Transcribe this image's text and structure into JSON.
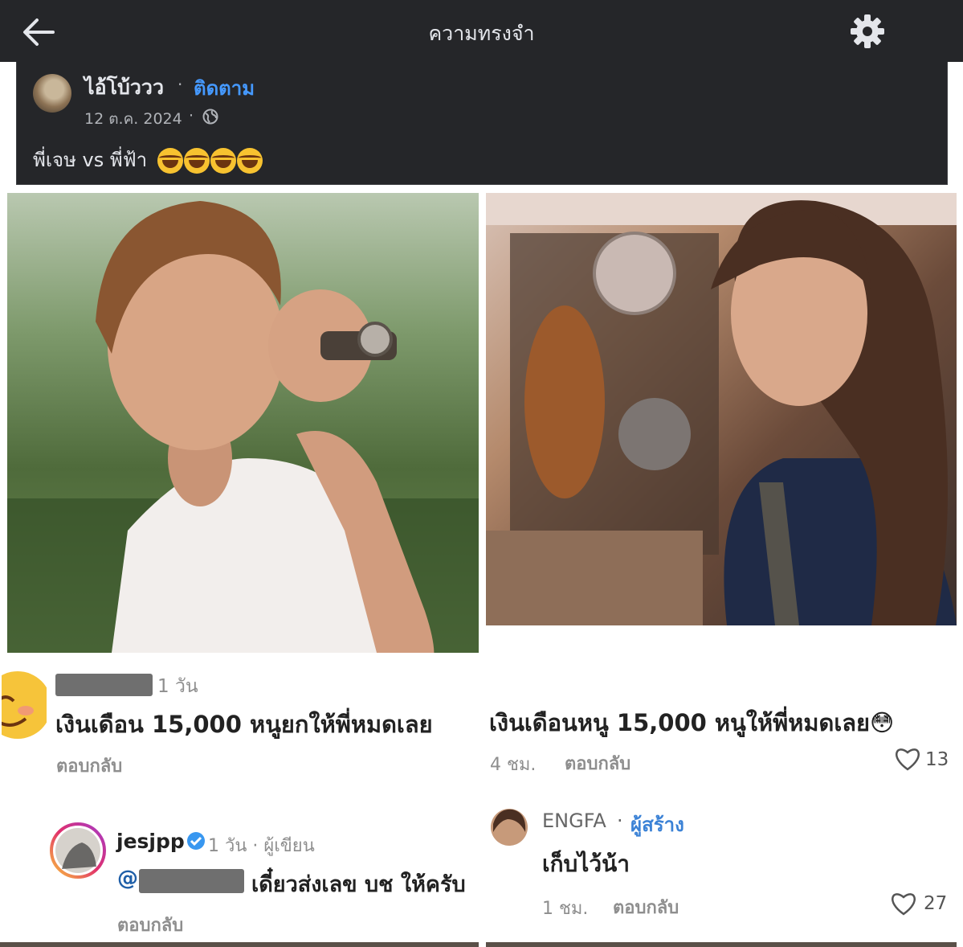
{
  "header": {
    "title": "ความทรงจำ"
  },
  "post": {
    "author": "ไอ้โบ้ววว",
    "separator": "·",
    "follow": "ติดตาม",
    "date": "12 ต.ค. 2024",
    "date_sep": "·",
    "message": "พี่เจษ vs พี่ฟ้า"
  },
  "left_card": {
    "comment_time": "1 วัน",
    "comment_text": "เงินเดือน 15,000 หนูยกให้พี่หมดเลย",
    "reply_label": "ตอบกลับ",
    "reply": {
      "username": "jesjpp",
      "meta": "1 วัน · ผู้เขียน",
      "mention_at": "@",
      "text": "เดี๋ยวส่งเลข บช ให้ครับ",
      "reply_label": "ตอบกลับ"
    }
  },
  "right_card": {
    "comment_text": "เงินเดือนหนู 15,000 หนูให้พี่หมดเลย😳",
    "comment_time": "4 ชม.",
    "reply_label": "ตอบกลับ",
    "likes": "13",
    "reply": {
      "username": "ENGFA",
      "sep": "·",
      "role": "ผู้สร้าง",
      "text": "เก็บไว้น้า",
      "time": "1 ชม.",
      "reply_label": "ตอบกลับ",
      "likes": "27"
    }
  },
  "colors": {
    "topbar": "#252629",
    "link": "#4599ff",
    "verified": "#3897f0"
  }
}
